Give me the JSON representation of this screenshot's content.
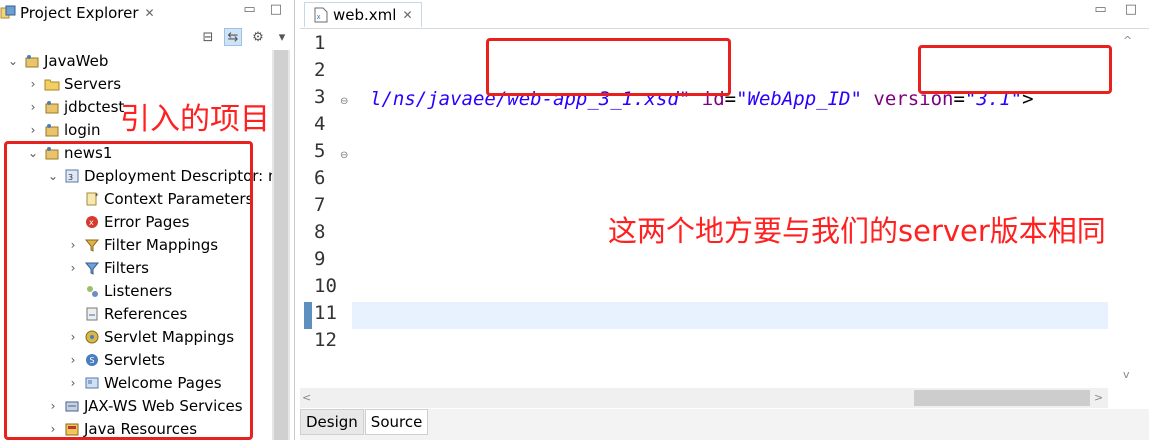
{
  "project_explorer": {
    "title": "Project Explorer",
    "close_icon": "✕",
    "tree": [
      {
        "label": "JavaWeb",
        "twisty": "open",
        "icon": "project-icon"
      },
      {
        "label": "Servers",
        "twisty": "closed",
        "icon": "folder-icon"
      },
      {
        "label": "jdbctest",
        "twisty": "closed",
        "icon": "project-icon"
      },
      {
        "label": "login",
        "twisty": "closed",
        "icon": "project-icon"
      },
      {
        "label": "news1",
        "twisty": "open",
        "icon": "project-icon"
      },
      {
        "label": "Deployment Descriptor: n",
        "twisty": "open",
        "icon": "deployment-descriptor-icon"
      },
      {
        "label": "Context Parameters",
        "twisty": "none",
        "icon": "context-param-icon"
      },
      {
        "label": "Error Pages",
        "twisty": "none",
        "icon": "error-icon"
      },
      {
        "label": "Filter Mappings",
        "twisty": "closed",
        "icon": "filter-mapping-icon"
      },
      {
        "label": "Filters",
        "twisty": "closed",
        "icon": "filter-icon"
      },
      {
        "label": "Listeners",
        "twisty": "none",
        "icon": "listener-icon"
      },
      {
        "label": "References",
        "twisty": "none",
        "icon": "reference-icon"
      },
      {
        "label": "Servlet Mappings",
        "twisty": "closed",
        "icon": "servlet-mapping-icon"
      },
      {
        "label": "Servlets",
        "twisty": "closed",
        "icon": "servlet-icon"
      },
      {
        "label": "Welcome Pages",
        "twisty": "closed",
        "icon": "welcome-page-icon"
      },
      {
        "label": "JAX-WS Web Services",
        "twisty": "closed",
        "icon": "web-service-icon"
      },
      {
        "label": "Java Resources",
        "twisty": "closed",
        "icon": "java-resources-icon"
      }
    ]
  },
  "editor": {
    "tab_title": "web.xml",
    "line_numbers": [
      "1",
      "2",
      "3",
      "4",
      "5",
      "6",
      "7",
      "8",
      "9",
      "10",
      "11",
      "12"
    ],
    "line2": {
      "schema_value": "l/ns/javaee/web-app_3_1.xsd\"",
      "id_attr": "id",
      "id_value": "\"WebApp_ID\"",
      "version_attr": "version",
      "version_value": "\"3.1\"",
      "close": ">"
    },
    "mode_tabs": [
      "Design",
      "Source"
    ],
    "selected_mode": "Source"
  },
  "annotations": {
    "imported_projects": "引入的项目",
    "server_version_note": "这两个地方要与我们的server版本相同"
  },
  "colors": {
    "annotation_red": "#e8201e",
    "xml_string": "#2a00ff",
    "xml_attribute": "#7f007f"
  }
}
